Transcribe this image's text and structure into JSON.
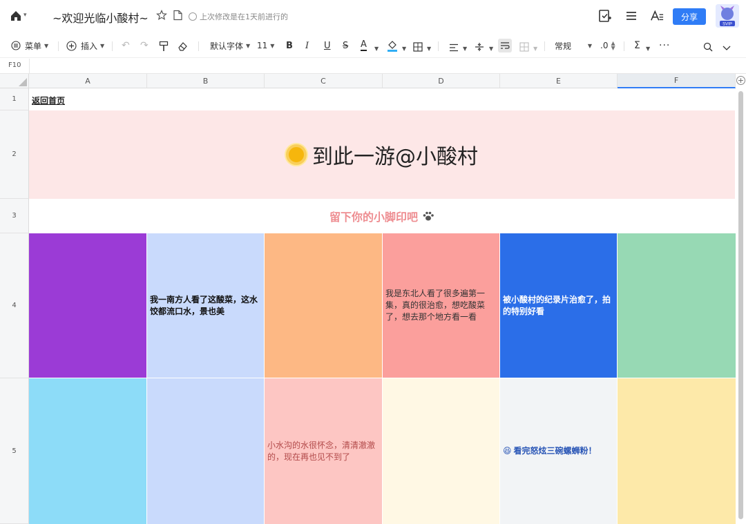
{
  "header": {
    "title": "~欢迎光临小酸村~",
    "save_status": "上次修改是在1天前进行的",
    "share_label": "分享",
    "avatar_badge": "SVIP"
  },
  "toolbar": {
    "menu_label": "菜单",
    "insert_label": "插入",
    "font_family": "默认字体",
    "font_size": "11",
    "format": "常规",
    "decimal": ".0"
  },
  "formula_bar": {
    "cell_ref": "F10",
    "value": ""
  },
  "columns": [
    "A",
    "B",
    "C",
    "D",
    "E",
    "F"
  ],
  "rows": [
    "1",
    "2",
    "3",
    "4",
    "5"
  ],
  "sheet": {
    "link": "返回首页",
    "banner": "到此一游@小酸村",
    "subtitle": "留下你的小脚印吧",
    "notes": {
      "b4": "我一南方人看了这酸菜，这水饺都流口水，景也美",
      "d4": "我是东北人看了很多遍第一集，真的很治愈，想吃酸菜了，想去那个地方看一看",
      "e4": "被小酸村的纪录片治愈了，拍的特别好看",
      "c5": "小水沟的水很怀念，清清澈澈的，现在再也见不到了",
      "e5": "看完怒炫三碗螺蛳粉！"
    }
  },
  "colors": {
    "accent": "#2f7cf6",
    "banner_bg": "#fde7e7",
    "subtitle": "#ee8d91",
    "a4": "#9b3bd6",
    "b4": "#c9dafc",
    "c4": "#fdb884",
    "d4": "#fb9f9c",
    "e4": "#2b6ee8",
    "f4": "#97d9b4",
    "a5": "#8ddcf8",
    "b5": "#c9dafc",
    "c5": "#fdc6c3",
    "d5": "#fff8e4",
    "e5": "#f2f4f6",
    "f5": "#fde9a9"
  }
}
